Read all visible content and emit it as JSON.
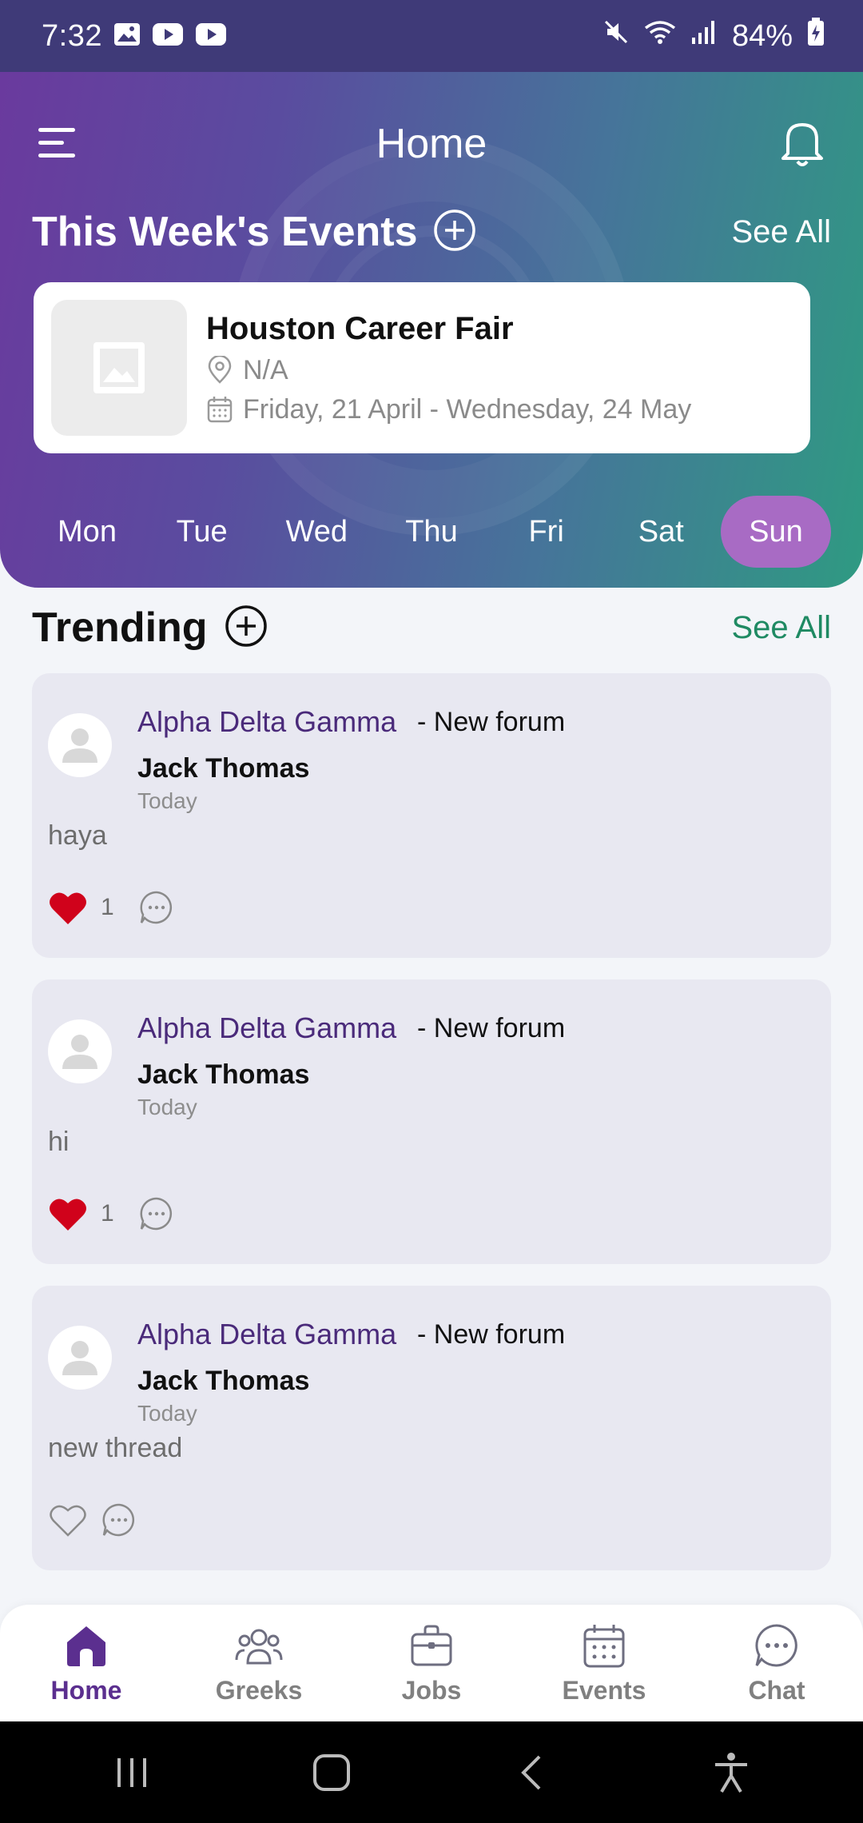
{
  "status_bar": {
    "time": "7:32",
    "battery": "84%",
    "icons": [
      "gallery-icon",
      "youtube-icon",
      "youtube-icon",
      "mute-icon",
      "wifi-icon",
      "signal-icon",
      "battery-charging-icon"
    ]
  },
  "header": {
    "title": "Home"
  },
  "events_section": {
    "title": "This Week's Events",
    "see_all": "See All",
    "card": {
      "name": "Houston Career Fair",
      "location": "N/A",
      "dates": "Friday, 21 April - Wednesday, 24 May"
    },
    "days": [
      {
        "label": "Mon",
        "active": false
      },
      {
        "label": "Tue",
        "active": false
      },
      {
        "label": "Wed",
        "active": false
      },
      {
        "label": "Thu",
        "active": false
      },
      {
        "label": "Fri",
        "active": false
      },
      {
        "label": "Sat",
        "active": false
      },
      {
        "label": "Sun",
        "active": true
      }
    ]
  },
  "trending": {
    "title": "Trending",
    "see_all": "See All",
    "posts": [
      {
        "group": "Alpha Delta Gamma",
        "type": "- New forum",
        "author": "Jack Thomas",
        "time": "Today",
        "body": "haya",
        "liked": true,
        "likes": "1"
      },
      {
        "group": "Alpha Delta Gamma",
        "type": "- New forum",
        "author": "Jack Thomas",
        "time": "Today",
        "body": "hi",
        "liked": true,
        "likes": "1"
      },
      {
        "group": "Alpha Delta Gamma",
        "type": "- New forum",
        "author": "Jack Thomas",
        "time": "Today",
        "body": "new thread",
        "liked": false,
        "likes": ""
      }
    ]
  },
  "bottom_nav": {
    "items": [
      {
        "label": "Home",
        "icon": "home-icon",
        "active": true
      },
      {
        "label": "Greeks",
        "icon": "people-icon",
        "active": false
      },
      {
        "label": "Jobs",
        "icon": "briefcase-icon",
        "active": false
      },
      {
        "label": "Events",
        "icon": "calendar-icon",
        "active": false
      },
      {
        "label": "Chat",
        "icon": "chat-icon",
        "active": false
      }
    ]
  },
  "colors": {
    "accent_purple": "#5b2f8f",
    "accent_green": "#1f8a63",
    "active_day": "#a86bc4",
    "like_red": "#d0021b"
  }
}
